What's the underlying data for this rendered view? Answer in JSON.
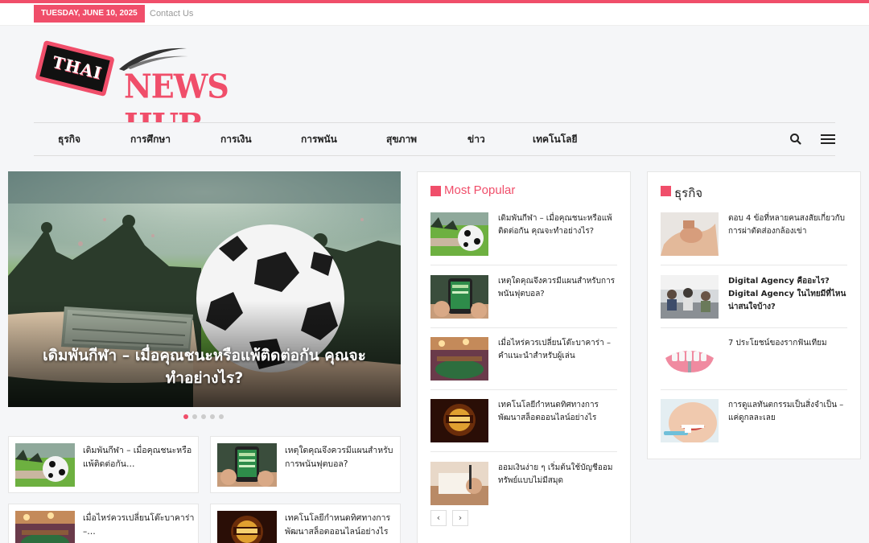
{
  "colors": {
    "accent": "#f04e6a",
    "text": "#222222",
    "muted": "#999999"
  },
  "topbar": {
    "date": "TUESDAY, JUNE 10, 2025",
    "contact": "Contact Us"
  },
  "logo": {
    "word1": "THAI",
    "word2": "NEWS HUB"
  },
  "nav": {
    "items": [
      "ธุรกิจ",
      "การศึกษา",
      "การเงิน",
      "การพนัน",
      "สุขภาพ",
      "ข่าว",
      "เทคโนโลยี"
    ],
    "icons": [
      "search-icon",
      "menu-icon"
    ]
  },
  "hero": {
    "title": "เดิมพันกีฬา – เมื่อคุณชนะหรือแพ้ติดต่อกัน คุณจะทำอย่างไร?",
    "slides": 5,
    "active_slide": 1
  },
  "cards": [
    {
      "title": "เดิมพันกีฬา – เมื่อคุณชนะหรือแพ้ติดต่อกัน…"
    },
    {
      "title": "เหตุใดคุณจึงควรมีแผนสำหรับการพนันฟุตบอล?"
    },
    {
      "title": "เมื่อไหร่ควรเปลี่ยนโต๊ะบาคาร่า –…"
    },
    {
      "title": "เทคโนโลยีกำหนดทิศทางการพัฒนาสล็อตออนไลน์อย่างไร"
    }
  ],
  "popular": {
    "heading": "Most Popular",
    "items": [
      {
        "title": "เดิมพันกีฬา – เมื่อคุณชนะหรือแพ้ติดต่อกัน คุณจะทำอย่างไร?"
      },
      {
        "title": "เหตุใดคุณจึงควรมีแผนสำหรับการพนันฟุตบอล?"
      },
      {
        "title": "เมื่อไหร่ควรเปลี่ยนโต๊ะบาคาร่า – คำแนะนำสำหรับผู้เล่น"
      },
      {
        "title": "เทคโนโลยีกำหนดทิศทางการพัฒนาสล็อตออนไลน์อย่างไร"
      },
      {
        "title": "ออมเงินง่าย ๆ เริ่มต้นใช้บัญชีออมทรัพย์แบบไม่มีสมุด"
      }
    ],
    "prev": "‹",
    "next": "›"
  },
  "business": {
    "heading": "ธุรกิจ",
    "items": [
      {
        "title": "ตอบ 4 ข้อที่หลายคนสงสัยเกี่ยวกับการผ่าตัดส่องกล้องเข่า"
      },
      {
        "title": "Digital Agency คืออะไร? Digital Agency ในไทยมีที่ไหนน่าสนใจบ้าง?"
      },
      {
        "title": "7 ประโยชน์ของรากฟันเทียม"
      },
      {
        "title": "การดูแลทันตกรรมเป็นสิ่งจำเป็น – แค่ดูกลละเลย"
      }
    ]
  }
}
